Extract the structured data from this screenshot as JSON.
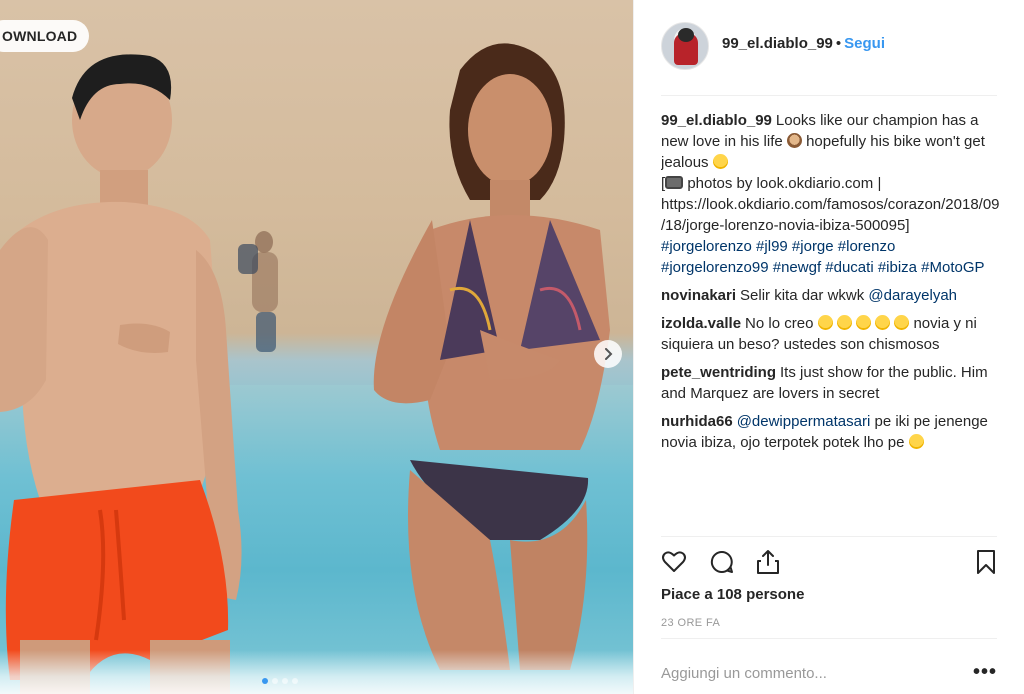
{
  "photo": {
    "download_label": "OWNLOAD",
    "next_icon": "chevron-right-icon",
    "carousel_dots": 4,
    "carousel_active": 1
  },
  "post": {
    "username": "99_el.diablo_99",
    "separator": "•",
    "follow_label": "Segui",
    "caption": {
      "user": "99_el.diablo_99",
      "text_1": "Looks like our champion has a new love in his life ",
      "text_2": "  hopefully his bike won't get jealous ",
      "text_3": "\n[",
      "text_4": "  photos by look.okdiario.com | https://look.okdiario.com/famosos/corazon/2018/09/18/jorge-lorenzo-novia-ibiza-500095]",
      "tags": "#jorgelorenzo #jl99 #jorge #lorenzo #jorgelorenzo99 #newgf #ducati #ibiza #MotoGP"
    },
    "comments": [
      {
        "user": "novinakari",
        "text": "Selir kita dar wkwk ",
        "mention": "@darayelyah"
      },
      {
        "user": "izolda.valle",
        "text_a": "No lo creo ",
        "text_b": "  novia y ni siquiera un beso? ustedes son chismosos"
      },
      {
        "user": "pete_wentriding",
        "text": "Its just show for the public. Him and Marquez are lovers in secret"
      },
      {
        "user": "nurhida66",
        "mention": "@dewippermatasari",
        "text": " pe iki pe jenenge novia ibiza, ojo terpotek potek lho pe "
      }
    ],
    "actions": {
      "like_icon": "heart-icon",
      "comment_icon": "comment-icon",
      "share_icon": "share-icon",
      "save_icon": "bookmark-icon"
    },
    "likes_text": "Piace a 108 persone",
    "time_text": "23 ORE FA",
    "comment_placeholder": "Aggiungi un commento...",
    "more_label": "•••"
  },
  "colors": {
    "accent": "#3897f0",
    "hashtag": "#003569",
    "muted": "#999999",
    "border": "#efefef"
  }
}
